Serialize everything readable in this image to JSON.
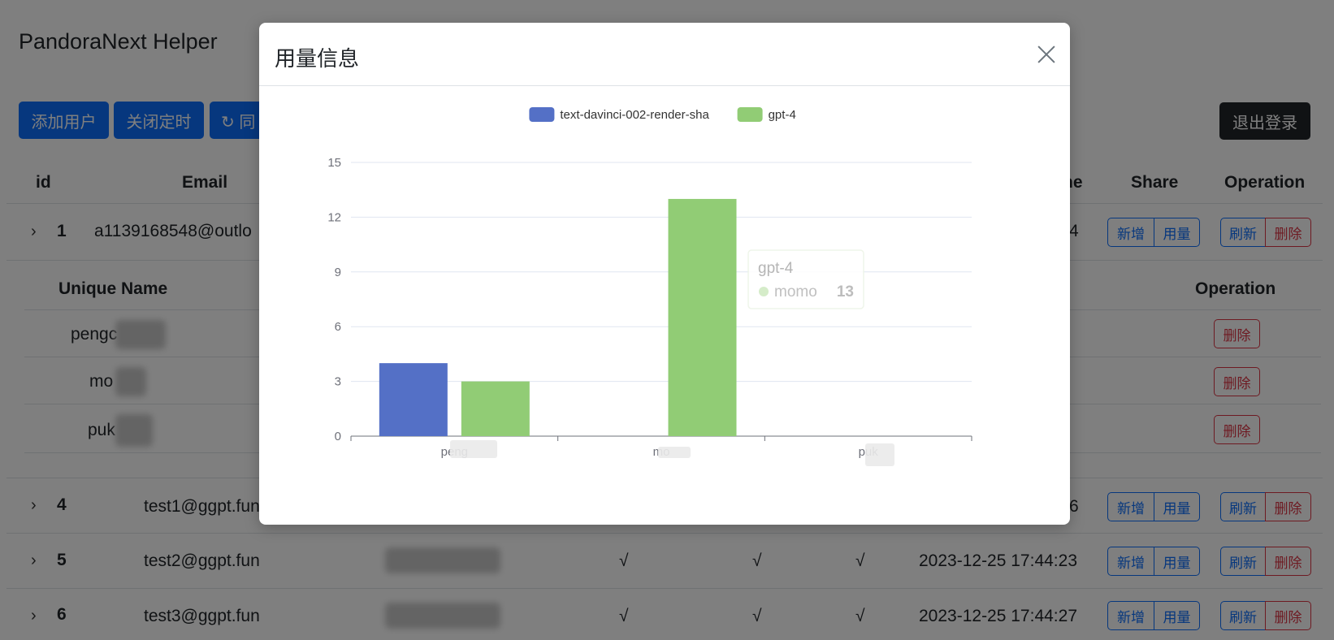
{
  "app": {
    "title": "PandoraNext Helper",
    "toolbar": {
      "add_user": "添加用户",
      "close_timer": "关闭定时",
      "sync_partial": "↻ 同",
      "logout": "退出登录"
    }
  },
  "table": {
    "headers": {
      "id": "id",
      "email": "Email",
      "time_partial": "ne",
      "share": "Share",
      "operation": "Operation"
    },
    "rows": [
      {
        "id": "1",
        "email": "a1139168548@outlo",
        "time_partial": "4"
      },
      {
        "id": "4",
        "email": "test1@ggpt.fun",
        "time_partial": "6"
      },
      {
        "id": "5",
        "email": "test2@ggpt.fun",
        "c1": "√",
        "c2": "√",
        "c3": "√",
        "time": "2023-12-25 17:44:23"
      },
      {
        "id": "6",
        "email": "test3@ggpt.fun",
        "c1": "√",
        "c2": "√",
        "c3": "√",
        "time": "2023-12-25 17:44:27"
      }
    ],
    "row_buttons": {
      "add": "新增",
      "usage": "用量",
      "refresh": "刷新",
      "delete": "删除"
    },
    "subtable": {
      "headers": {
        "unique_name": "Unique Name",
        "operation": "Operation"
      },
      "rows": [
        {
          "name": "pengc"
        },
        {
          "name": "mo"
        },
        {
          "name": "puk"
        }
      ],
      "delete_label": "删除"
    }
  },
  "modal": {
    "title": "用量信息",
    "tooltip": {
      "series": "gpt-4",
      "label": "momo",
      "value": "13"
    }
  },
  "chart_data": {
    "type": "bar",
    "categories": [
      "peng",
      "mo",
      "puk"
    ],
    "series": [
      {
        "name": "text-davinci-002-render-sha",
        "color": "#5470c6",
        "values": [
          4,
          0,
          0
        ]
      },
      {
        "name": "gpt-4",
        "color": "#91cc75",
        "values": [
          3,
          13,
          0
        ]
      }
    ],
    "ylim": [
      0,
      15
    ],
    "yticks": [
      0,
      3,
      6,
      9,
      12,
      15
    ],
    "grid": true,
    "legend": "top-center"
  }
}
